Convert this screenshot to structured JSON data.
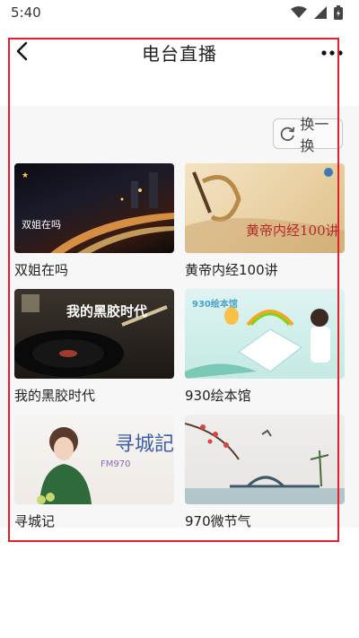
{
  "status_bar": {
    "time": "5:40",
    "icons": [
      "wifi-icon",
      "cell-signal-icon",
      "battery-icon"
    ]
  },
  "header": {
    "title": "电台直播",
    "back_icon": "back-arrow-icon",
    "more_icon": "more-dots-icon"
  },
  "controls": {
    "swap_label": "换一换",
    "swap_icon": "refresh-icon"
  },
  "cards": [
    {
      "title": "双姐在吗",
      "art_text": "双姐在吗"
    },
    {
      "title": "黄帝内经100讲",
      "art_text": "黄帝内经100讲"
    },
    {
      "title": "我的黑胶时代",
      "art_text": "我的黑胶时代"
    },
    {
      "title": "930绘本馆",
      "art_text": "930绘本馆"
    },
    {
      "title": "寻城记",
      "art_text": "寻城記",
      "art_subtext": "FM970"
    },
    {
      "title": "970微节气",
      "art_text": ""
    }
  ],
  "colors": {
    "highlight_border": "#e0202a",
    "content_bg": "#f7f7f7"
  }
}
